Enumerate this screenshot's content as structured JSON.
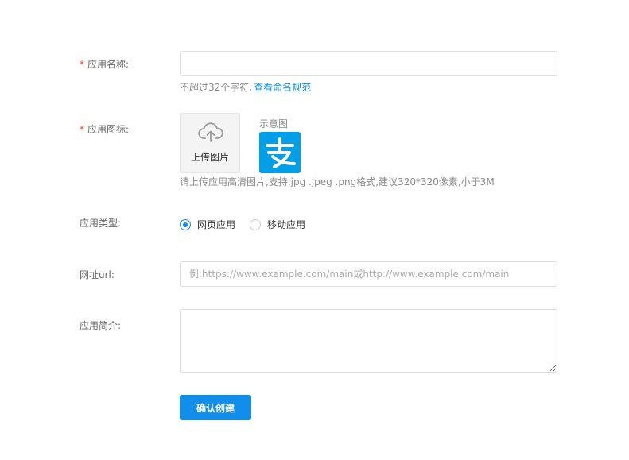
{
  "form": {
    "app_name": {
      "required_mark": "*",
      "label": "应用名称:",
      "value": "",
      "placeholder": "",
      "help_text": "不超过32个字符,",
      "help_link": "查看命名规范"
    },
    "app_icon": {
      "required_mark": "*",
      "label": "应用图标:",
      "upload_label": "上传图片",
      "upload_icon": "cloud-upload-icon",
      "sample_label": "示意图",
      "sample_image": "alipay-logo",
      "sample_image_color": "#009FE8",
      "help_text": "请上传应用高清图片,支持.jpg .jpeg .png格式,建议320*320像素,小于3M"
    },
    "app_type": {
      "label": "应用类型:",
      "options": [
        {
          "label": "网页应用",
          "checked": true
        },
        {
          "label": "移动应用",
          "checked": false
        }
      ]
    },
    "url": {
      "label": "网址url:",
      "value": "",
      "placeholder": "例:https://www.example.com/main或http://www.example.com/main"
    },
    "description": {
      "label": "应用简介:",
      "value": ""
    },
    "submit": {
      "label": "确认创建"
    }
  },
  "colors": {
    "primary": "#108EE9",
    "required": "#F04134",
    "border": "#DCDCDC",
    "label_text": "#666666",
    "help_text": "#888888"
  }
}
